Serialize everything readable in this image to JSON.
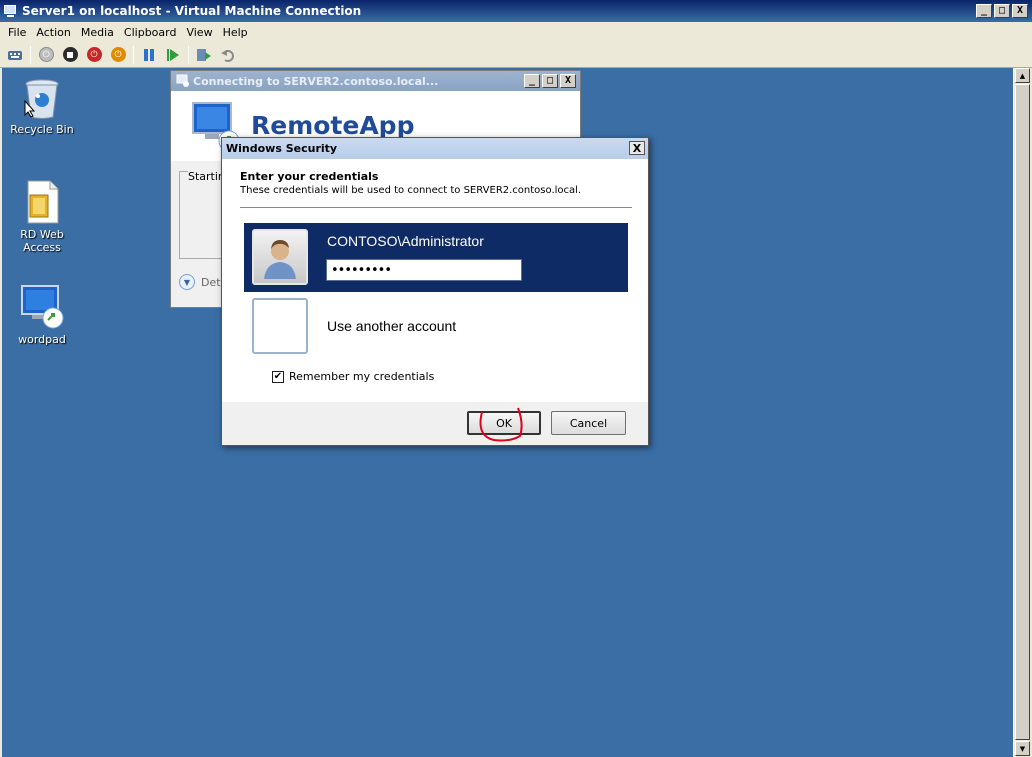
{
  "host": {
    "title": "Server1 on localhost - Virtual Machine Connection",
    "caption_buttons": {
      "minimize": "_",
      "maximize": "□",
      "close": "X"
    },
    "menu": [
      "File",
      "Action",
      "Media",
      "Clipboard",
      "View",
      "Help"
    ],
    "toolbar_icons": [
      "ctrl-alt-del-icon",
      "power-off-icon",
      "stop-icon",
      "shutdown-icon",
      "power-on-icon",
      "pause-icon",
      "resume-icon",
      "snapshot-icon",
      "revert-icon"
    ]
  },
  "desktop": {
    "background_color": "#3a6ea5",
    "icons": [
      {
        "label": "Recycle Bin",
        "icon": "recycle-bin-icon"
      },
      {
        "label": "RD Web\nAccess",
        "icon": "document-icon"
      },
      {
        "label": "wordpad",
        "icon": "remoteapp-icon"
      }
    ]
  },
  "connecting_window": {
    "title": "Connecting to SERVER2.contoso.local...",
    "brand": "RemoteApp",
    "status": "Starting",
    "details": "Det"
  },
  "security_dialog": {
    "title": "Windows Security",
    "close": "X",
    "heading": "Enter your credentials",
    "subtext": "These credentials will be used to connect to SERVER2.contoso.local.",
    "selected_account": "CONTOSO\\Administrator",
    "password_value": "●●●●●●●●●",
    "other_account": "Use another account",
    "remember_label": "Remember my credentials",
    "remember_checked": "✔",
    "ok": "OK",
    "cancel": "Cancel"
  },
  "colors": {
    "selected_tile": "#0f2b66",
    "brand_text": "#1f4b99",
    "annotation_red": "#e0001b"
  }
}
